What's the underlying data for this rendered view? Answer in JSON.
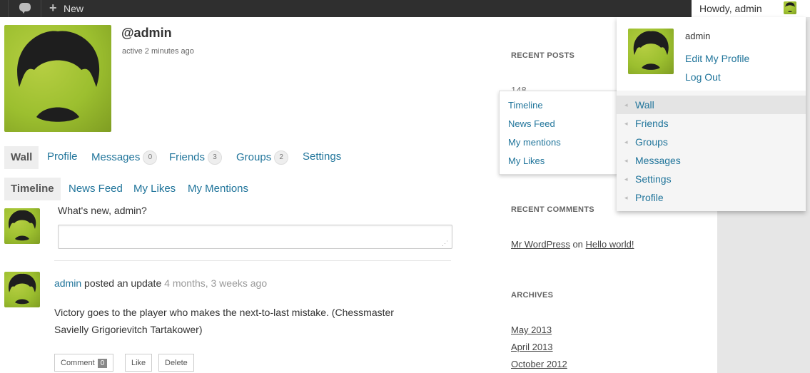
{
  "adminbar": {
    "new_label": "New",
    "notifications": "0",
    "howdy": "Howdy, admin"
  },
  "profile": {
    "username": "@admin",
    "activity": "active 2 minutes ago"
  },
  "nav": {
    "items": [
      {
        "label": "Wall"
      },
      {
        "label": "Profile"
      },
      {
        "label": "Messages",
        "count": "0"
      },
      {
        "label": "Friends",
        "count": "3"
      },
      {
        "label": "Groups",
        "count": "2"
      },
      {
        "label": "Settings"
      }
    ]
  },
  "subnav": {
    "items": [
      "Timeline",
      "News Feed",
      "My Likes",
      "My Mentions"
    ]
  },
  "post_form": {
    "prompt": "What's new, admin?",
    "value": ""
  },
  "activity_item": {
    "user": "admin",
    "action": "posted an update",
    "time": "4 months, 3 weeks ago",
    "content": "Victory goes to the player who makes the next-to-last mistake. (Chessmaster Savielly Grigorievitch Tartakower)",
    "buttons": {
      "comment": "Comment",
      "comment_count": "0",
      "like": "Like",
      "delete": "Delete"
    }
  },
  "sidebar": {
    "recent_posts_title": "RECENT POSTS",
    "recent_posts_partial": "148",
    "recent_comments_title": "RECENT COMMENTS",
    "comment": {
      "author": "Mr WordPress",
      "on": "on",
      "post": "Hello world!"
    },
    "archives_title": "ARCHIVES",
    "archives": [
      "May 2013",
      "April 2013",
      "October 2012"
    ]
  },
  "wall_submenu": {
    "items": [
      "Timeline",
      "News Feed",
      "My mentions",
      "My Likes"
    ]
  },
  "user_dropdown": {
    "name": "admin",
    "edit_profile": "Edit My Profile",
    "logout": "Log Out",
    "menu": [
      "Wall",
      "Friends",
      "Groups",
      "Messages",
      "Settings",
      "Profile"
    ]
  },
  "colors": {
    "link": "#21759b",
    "adminbar": "#2f2f2f",
    "avatar": "#9cbf2f"
  }
}
